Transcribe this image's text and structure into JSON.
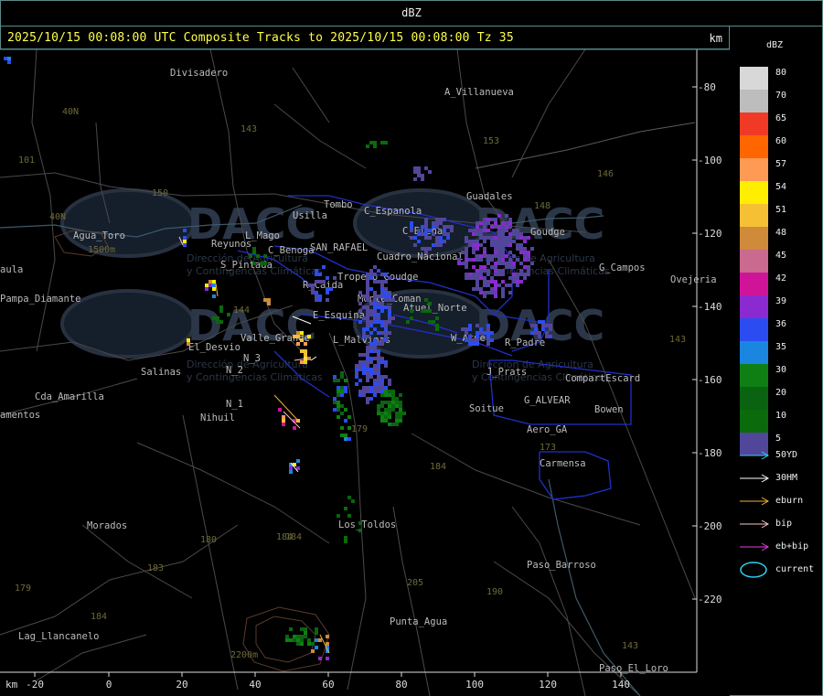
{
  "header": {
    "product_label": "dBZ"
  },
  "title": {
    "text": "2025/10/15 00:08:00 UTC Composite Tracks to 2025/10/15 00:08:00 Tz 35",
    "unit": "km"
  },
  "legend": {
    "title": "dBZ",
    "scale": [
      {
        "label": "80",
        "color": "#d8d8d8"
      },
      {
        "label": "70",
        "color": "#bdbdbd"
      },
      {
        "label": "65",
        "color": "#f03a26"
      },
      {
        "label": "60",
        "color": "#ff6600"
      },
      {
        "label": "57",
        "color": "#ff9a55"
      },
      {
        "label": "54",
        "color": "#ffee00"
      },
      {
        "label": "51",
        "color": "#f5c034"
      },
      {
        "label": "48",
        "color": "#cf8a3a"
      },
      {
        "label": "45",
        "color": "#c96a8e"
      },
      {
        "label": "42",
        "color": "#d0149a"
      },
      {
        "label": "39",
        "color": "#8a2ad0"
      },
      {
        "label": "36",
        "color": "#2b4cf0"
      },
      {
        "label": "35",
        "color": "#1a86e0"
      },
      {
        "label": "30",
        "color": "#0f7f14"
      },
      {
        "label": "20",
        "color": "#0a6310"
      },
      {
        "label": "10",
        "color": "#0b6a0b"
      },
      {
        "label": "5",
        "color": "#51469a"
      }
    ],
    "tracks": [
      {
        "label": "50YD",
        "color": "#2fd0f0"
      },
      {
        "label": "30HM",
        "color": "#ffffff"
      },
      {
        "label": "eburn",
        "color": "#f5b030"
      },
      {
        "label": "bip",
        "color": "#f4c6c6"
      },
      {
        "label": "eb+bip",
        "color": "#e040e0"
      }
    ],
    "current_label": "current",
    "current_color": "#2fd0f0"
  },
  "axes": {
    "x_unit": "km",
    "x_ticks": [
      "-20",
      "0",
      "20",
      "40",
      "60",
      "80",
      "100",
      "120",
      "140"
    ],
    "y_ticks": [
      "-80",
      "-100",
      "-120",
      "-140",
      "-160",
      "-180",
      "-200",
      "-220"
    ]
  },
  "places": [
    {
      "name": "Divisadero"
    },
    {
      "name": "A_Villanueva"
    },
    {
      "name": "Guadales"
    },
    {
      "name": "Usilla"
    },
    {
      "name": "Tombo"
    },
    {
      "name": "C_Espanola"
    },
    {
      "name": "C_Elena"
    },
    {
      "name": "Goudge"
    },
    {
      "name": "G_Campos"
    },
    {
      "name": "Agua_Toro"
    },
    {
      "name": "Reyunos"
    },
    {
      "name": "L_Mago"
    },
    {
      "name": "C_Benoga"
    },
    {
      "name": "SAN_RAFAEL"
    },
    {
      "name": "Cuadro_Nacional"
    },
    {
      "name": "Pampa_Diamante"
    },
    {
      "name": "S_Pintada"
    },
    {
      "name": "Tropero Goudge"
    },
    {
      "name": "R_Caida"
    },
    {
      "name": "Monte_Coman"
    },
    {
      "name": "Atuel_Norte"
    },
    {
      "name": "E_Esquina"
    },
    {
      "name": "Valle_Grande"
    },
    {
      "name": "L_Malvinas"
    },
    {
      "name": "W_Atuel"
    },
    {
      "name": "R_Padre"
    },
    {
      "name": "El_Desvio"
    },
    {
      "name": "N_2"
    },
    {
      "name": "N_3"
    },
    {
      "name": "Salinas"
    },
    {
      "name": "J_Prats"
    },
    {
      "name": "CompartEscard"
    },
    {
      "name": "Cda_Amarilla"
    },
    {
      "name": "N_1"
    },
    {
      "name": "G_ALVEAR"
    },
    {
      "name": "Soitue"
    },
    {
      "name": "Bowen"
    },
    {
      "name": "Nihuil"
    },
    {
      "name": "Aero_GA"
    },
    {
      "name": "Carmensa"
    },
    {
      "name": "Morados"
    },
    {
      "name": "Los_Toldos"
    },
    {
      "name": "Paso_Barroso"
    },
    {
      "name": "Punta_Agua"
    },
    {
      "name": "Lag_Llancanelo"
    },
    {
      "name": "Paso_El_Loro"
    },
    {
      "name": "Ovejeria"
    },
    {
      "name": "aula"
    },
    {
      "name": "amentos"
    }
  ],
  "roads": [
    "40N",
    "143",
    "153",
    "146",
    "148",
    "150",
    "101",
    "40N",
    "144",
    "179",
    "184",
    "180",
    "184",
    "183",
    "184",
    "190",
    "173",
    "143",
    "143",
    "205",
    "179",
    "184"
  ],
  "terrain": {
    "labels": [
      "1500m",
      "2200m"
    ]
  },
  "watermark": {
    "brand": "DACC",
    "subtitle_1": "Dirección de Agricultura",
    "subtitle_2": "y Contingencias Climáticas"
  }
}
